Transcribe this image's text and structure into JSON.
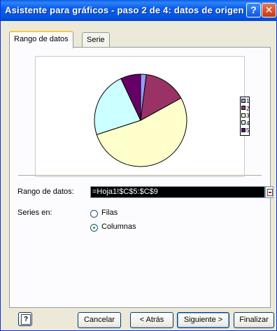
{
  "window": {
    "title": "Asistente para gráficos - paso 2 de 4: datos de origen",
    "help_glyph": "?",
    "close_glyph": "✕"
  },
  "tabs": [
    {
      "label": "Rango de datos",
      "active": true
    },
    {
      "label": "Serie",
      "active": false
    }
  ],
  "chart_data": {
    "type": "pie",
    "categories": [
      "1",
      "2",
      "3",
      "4",
      "5"
    ],
    "values": [
      2,
      15,
      53,
      23,
      7
    ],
    "colors": [
      "#9999FF",
      "#993366",
      "#FFFFCC",
      "#CCFFFF",
      "#660066"
    ],
    "legend_position": "right"
  },
  "form": {
    "range_label": "Rango de datos:",
    "range_value": "=Hoja1!$C$5:$C$9",
    "series_label": "Series en:",
    "option_rows": "Filas",
    "option_columns": "Columnas",
    "selected": "Columnas"
  },
  "buttons": {
    "cancel": "Cancelar",
    "back": "< Atrás",
    "next": "Siguiente >",
    "finish": "Finalizar"
  }
}
